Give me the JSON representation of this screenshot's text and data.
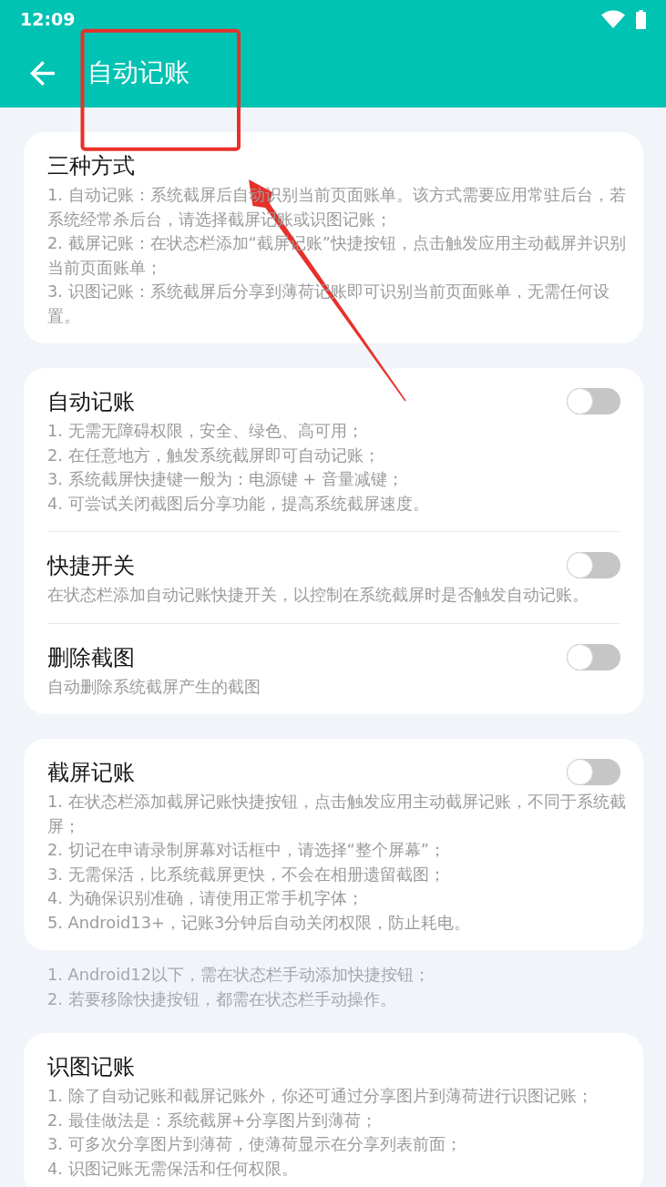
{
  "status_bar": {
    "time": "12:09"
  },
  "app_bar": {
    "title": "自动记账"
  },
  "sections": [
    {
      "kind": "card",
      "rows": [
        {
          "kind": "plain",
          "title": "三种方式",
          "lines": [
            "1. 自动记账：系统截屏后自动识别当前页面账单。该方式需要应用常驻后台，若系统经常杀后台，请选择截屏记账或识图记账；",
            "2. 截屏记账：在状态栏添加“截屏记账”快捷按钮，点击触发应用主动截屏并识别当前页面账单；",
            "3. 识图记账：系统截屏后分享到薄荷记账即可识别当前页面账单，无需任何设置。"
          ]
        }
      ]
    },
    {
      "kind": "card",
      "rows": [
        {
          "kind": "toggle",
          "title": "自动记账",
          "on": false,
          "lines": [
            "1. 无需无障碍权限，安全、绿色、高可用；",
            "2. 在任意地方，触发系统截屏即可自动记账；",
            "3. 系统截屏快捷键一般为：电源键 + 音量减键；",
            "4. 可尝试关闭截图后分享功能，提高系统截屏速度。"
          ]
        },
        {
          "kind": "toggle",
          "title": "快捷开关",
          "on": false,
          "lines": [
            "在状态栏添加自动记账快捷开关，以控制在系统截屏时是否触发自动记账。"
          ]
        },
        {
          "kind": "toggle",
          "title": "删除截图",
          "on": false,
          "lines": [
            "自动删除系统截屏产生的截图"
          ]
        }
      ]
    },
    {
      "kind": "card",
      "rows": [
        {
          "kind": "toggle",
          "title": "截屏记账",
          "on": false,
          "lines": [
            "1. 在状态栏添加截屏记账快捷按钮，点击触发应用主动截屏记账，不同于系统截屏；",
            "2. 切记在申请录制屏幕对话框中，请选择“整个屏幕”；",
            "3. 无需保活，比系统截屏更快，不会在相册遗留截图；",
            "4. 为确保识别准确，请使用正常手机字体；",
            "5. Android13+，记账3分钟后自动关闭权限，防止耗电。"
          ]
        }
      ]
    },
    {
      "kind": "note",
      "lines": [
        "1. Android12以下，需在状态栏手动添加快捷按钮；",
        "2. 若要移除快捷按钮，都需在状态栏手动操作。"
      ]
    },
    {
      "kind": "card",
      "rows": [
        {
          "kind": "plain",
          "title": "识图记账",
          "lines": [
            "1. 除了自动记账和截屏记账外，你还可通过分享图片到薄荷进行识图记账；",
            "2. 最佳做法是：系统截屏+分享图片到薄荷；",
            "3. 可多次分享图片到薄荷，使薄荷显示在分享列表前面；",
            "4. 识图记账无需保活和任何权限。"
          ]
        }
      ]
    }
  ]
}
